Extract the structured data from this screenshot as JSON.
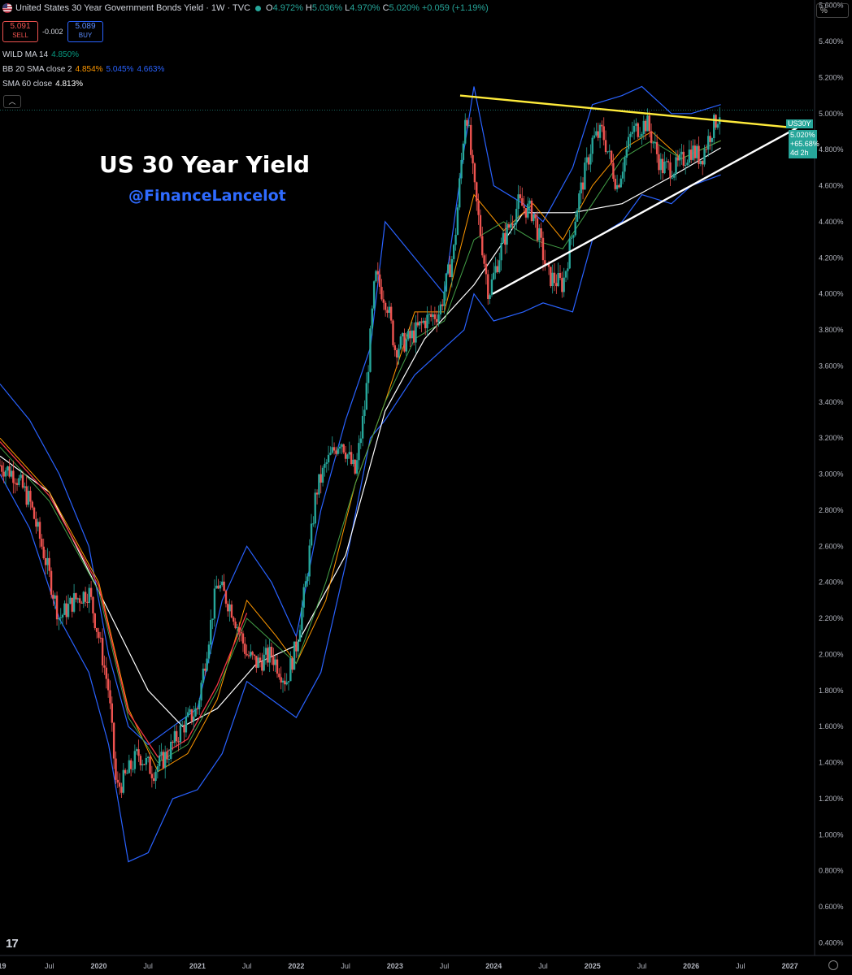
{
  "header": {
    "title": "United States 30 Year Government Bonds Yield · 1W · TVC",
    "ohlc": [
      {
        "label": "O",
        "value": "4.972%"
      },
      {
        "label": "H",
        "value": "5.036%"
      },
      {
        "label": "L",
        "value": "4.970%"
      },
      {
        "label": "C",
        "value": "5.020%"
      },
      {
        "label": "",
        "value": "+0.059 (+1.19%)"
      }
    ],
    "sell_price": "5.091",
    "sell_label": "SELL",
    "spread": "-0.002",
    "buy_price": "5.089",
    "buy_label": "BUY",
    "unit_button": "%",
    "collapse_icon": "chevron-up-icon"
  },
  "indicators": [
    {
      "name": "WILD MA 14",
      "values": [
        "4.850%"
      ],
      "colors": [
        "#089981"
      ]
    },
    {
      "name": "BB 20 SMA close 2",
      "values": [
        "4.854%",
        "5.045%",
        "4.663%"
      ],
      "colors": [
        "#ff9800",
        "#2962ff",
        "#2962ff"
      ]
    },
    {
      "name": "SMA 60 close",
      "values": [
        "4.813%"
      ],
      "colors": [
        "#ffffff"
      ]
    }
  ],
  "annotations": {
    "title": "US 30 Year Yield",
    "handle": "@FinanceLancelot"
  },
  "price_tag": {
    "symbol": "US30Y",
    "price": "5.020%",
    "change": "+65.68%",
    "countdown": "4d 2h"
  },
  "branding": {
    "logo": "17",
    "logo_icon": "tradingview-logo-icon"
  },
  "colors": {
    "up": "#26a69a",
    "down": "#ef5350",
    "bb": "#2962ff",
    "wild": "#43a047",
    "bbmid": "#ff9800",
    "sma60": "#ffffff",
    "resistance": "#ffeb3b",
    "support": "#ffffff",
    "ma_red": "#f23645"
  },
  "chart_data": {
    "type": "line",
    "x_tick_labels": [
      "019",
      "Jul",
      "2020",
      "Jul",
      "2021",
      "Jul",
      "2022",
      "Jul",
      "2023",
      "Jul",
      "2024",
      "Jul",
      "2025",
      "Jul",
      "2026",
      "Jul",
      "2027"
    ],
    "x_tick_dates": [
      "2019.0",
      "2019.5",
      "2020.0",
      "2020.5",
      "2021.0",
      "2021.5",
      "2022.0",
      "2022.5",
      "2023.0",
      "2023.5",
      "2024.0",
      "2024.5",
      "2025.0",
      "2025.5",
      "2026.0",
      "2026.5",
      "2027.0"
    ],
    "y_tick_labels": [
      "0.400%",
      "0.600%",
      "0.800%",
      "1.000%",
      "1.200%",
      "1.400%",
      "1.600%",
      "1.800%",
      "2.000%",
      "2.200%",
      "2.400%",
      "2.600%",
      "2.800%",
      "3.000%",
      "3.200%",
      "3.400%",
      "3.600%",
      "3.800%",
      "4.000%",
      "4.200%",
      "4.400%",
      "4.600%",
      "4.800%",
      "5.000%",
      "5.200%",
      "5.400%",
      "5.600%"
    ],
    "ylim": [
      0.33,
      5.63
    ],
    "xlim": [
      2019.0,
      2027.25
    ],
    "grid": false,
    "price_series": {
      "name": "US30Y",
      "x": [
        2019.0,
        2019.15,
        2019.3,
        2019.45,
        2019.6,
        2019.75,
        2019.9,
        2020.0,
        2020.1,
        2020.18,
        2020.25,
        2020.4,
        2020.55,
        2020.7,
        2020.85,
        2021.0,
        2021.1,
        2021.2,
        2021.35,
        2021.5,
        2021.6,
        2021.75,
        2021.9,
        2022.0,
        2022.1,
        2022.2,
        2022.3,
        2022.45,
        2022.6,
        2022.7,
        2022.8,
        2022.92,
        2023.0,
        2023.15,
        2023.3,
        2023.45,
        2023.6,
        2023.72,
        2023.8,
        2023.95,
        2024.1,
        2024.25,
        2024.4,
        2024.55,
        2024.7,
        2024.85,
        2025.0,
        2025.1,
        2025.25,
        2025.4,
        2025.55,
        2025.7,
        2025.85,
        2026.0,
        2026.1,
        2026.2,
        2026.3
      ],
      "y": [
        3.05,
        3.0,
        2.85,
        2.55,
        2.2,
        2.3,
        2.35,
        2.1,
        1.8,
        1.25,
        1.3,
        1.45,
        1.35,
        1.45,
        1.6,
        1.7,
        2.05,
        2.4,
        2.25,
        2.0,
        1.95,
        2.0,
        1.85,
        2.05,
        2.4,
        2.9,
        3.05,
        3.2,
        3.0,
        3.4,
        4.1,
        3.95,
        3.7,
        3.75,
        3.85,
        3.9,
        4.25,
        5.05,
        4.6,
        4.0,
        4.3,
        4.5,
        4.45,
        4.1,
        4.05,
        4.5,
        4.85,
        4.9,
        4.6,
        4.9,
        4.95,
        4.7,
        4.7,
        4.8,
        4.75,
        4.9,
        5.02
      ]
    },
    "trendlines": [
      {
        "name": "resistance",
        "x": [
          2023.66,
          2027.07
        ],
        "y": [
          5.1,
          4.92
        ]
      },
      {
        "name": "support",
        "x": [
          2023.99,
          2027.07
        ],
        "y": [
          4.0,
          4.92
        ]
      }
    ],
    "sma60": {
      "x": [
        2019.0,
        2019.5,
        2020.0,
        2020.5,
        2020.85,
        2021.2,
        2021.6,
        2022.0,
        2022.5,
        2022.9,
        2023.3,
        2023.8,
        2024.3,
        2024.8,
        2025.3,
        2025.8,
        2026.3
      ],
      "y": [
        3.1,
        2.9,
        2.35,
        1.8,
        1.6,
        1.7,
        1.95,
        2.05,
        2.55,
        3.35,
        3.75,
        4.05,
        4.45,
        4.45,
        4.5,
        4.65,
        4.81
      ]
    },
    "bb_upper": {
      "x": [
        2019.0,
        2019.3,
        2019.6,
        2019.9,
        2020.1,
        2020.3,
        2020.5,
        2020.75,
        2021.0,
        2021.25,
        2021.5,
        2021.75,
        2022.0,
        2022.25,
        2022.5,
        2022.75,
        2022.9,
        2023.2,
        2023.5,
        2023.7,
        2023.8,
        2024.0,
        2024.3,
        2024.5,
        2024.8,
        2025.0,
        2025.3,
        2025.5,
        2025.8,
        2026.0,
        2026.3
      ],
      "y": [
        3.5,
        3.3,
        3.0,
        2.6,
        2.0,
        1.6,
        1.5,
        1.6,
        1.7,
        2.3,
        2.6,
        2.4,
        2.1,
        2.8,
        3.3,
        3.7,
        4.4,
        4.2,
        4.0,
        4.8,
        5.15,
        4.6,
        4.5,
        4.4,
        4.7,
        5.05,
        5.1,
        5.15,
        5.0,
        5.0,
        5.05
      ]
    },
    "bb_lower": {
      "x": [
        2019.0,
        2019.3,
        2019.6,
        2019.9,
        2020.1,
        2020.3,
        2020.5,
        2020.75,
        2021.0,
        2021.25,
        2021.5,
        2021.75,
        2022.0,
        2022.25,
        2022.5,
        2022.75,
        2022.9,
        2023.2,
        2023.5,
        2023.7,
        2023.8,
        2024.0,
        2024.3,
        2024.5,
        2024.8,
        2025.0,
        2025.3,
        2025.5,
        2025.8,
        2026.0,
        2026.3
      ],
      "y": [
        3.0,
        2.7,
        2.2,
        1.9,
        1.5,
        0.85,
        0.9,
        1.2,
        1.25,
        1.45,
        1.85,
        1.75,
        1.65,
        1.9,
        2.5,
        3.2,
        3.3,
        3.55,
        3.7,
        3.8,
        4.0,
        3.85,
        3.9,
        3.95,
        3.9,
        4.3,
        4.4,
        4.55,
        4.5,
        4.6,
        4.66
      ]
    },
    "wild_ma": {
      "x": [
        2019.0,
        2019.5,
        2020.0,
        2020.3,
        2020.6,
        2020.9,
        2021.2,
        2021.5,
        2021.8,
        2022.0,
        2022.3,
        2022.6,
        2022.9,
        2023.2,
        2023.5,
        2023.8,
        2024.1,
        2024.4,
        2024.7,
        2025.0,
        2025.3,
        2025.6,
        2025.9,
        2026.3
      ],
      "y": [
        3.15,
        2.85,
        2.35,
        1.65,
        1.4,
        1.5,
        1.8,
        2.2,
        2.05,
        1.95,
        2.4,
        2.95,
        3.4,
        3.75,
        3.85,
        4.3,
        4.4,
        4.3,
        4.25,
        4.5,
        4.75,
        4.85,
        4.75,
        4.85
      ]
    },
    "bb_mid": {
      "x": [
        2019.0,
        2019.5,
        2020.0,
        2020.3,
        2020.6,
        2020.9,
        2021.2,
        2021.5,
        2021.8,
        2022.0,
        2022.3,
        2022.6,
        2022.9,
        2023.2,
        2023.5,
        2023.8,
        2024.1,
        2024.4,
        2024.7,
        2025.0,
        2025.3,
        2025.6,
        2025.9,
        2026.3
      ],
      "y": [
        3.2,
        2.9,
        2.4,
        1.7,
        1.35,
        1.45,
        1.75,
        2.3,
        2.1,
        1.95,
        2.3,
        2.95,
        3.4,
        3.9,
        3.9,
        4.55,
        4.35,
        4.5,
        4.3,
        4.6,
        4.8,
        4.9,
        4.75,
        4.85
      ]
    }
  }
}
